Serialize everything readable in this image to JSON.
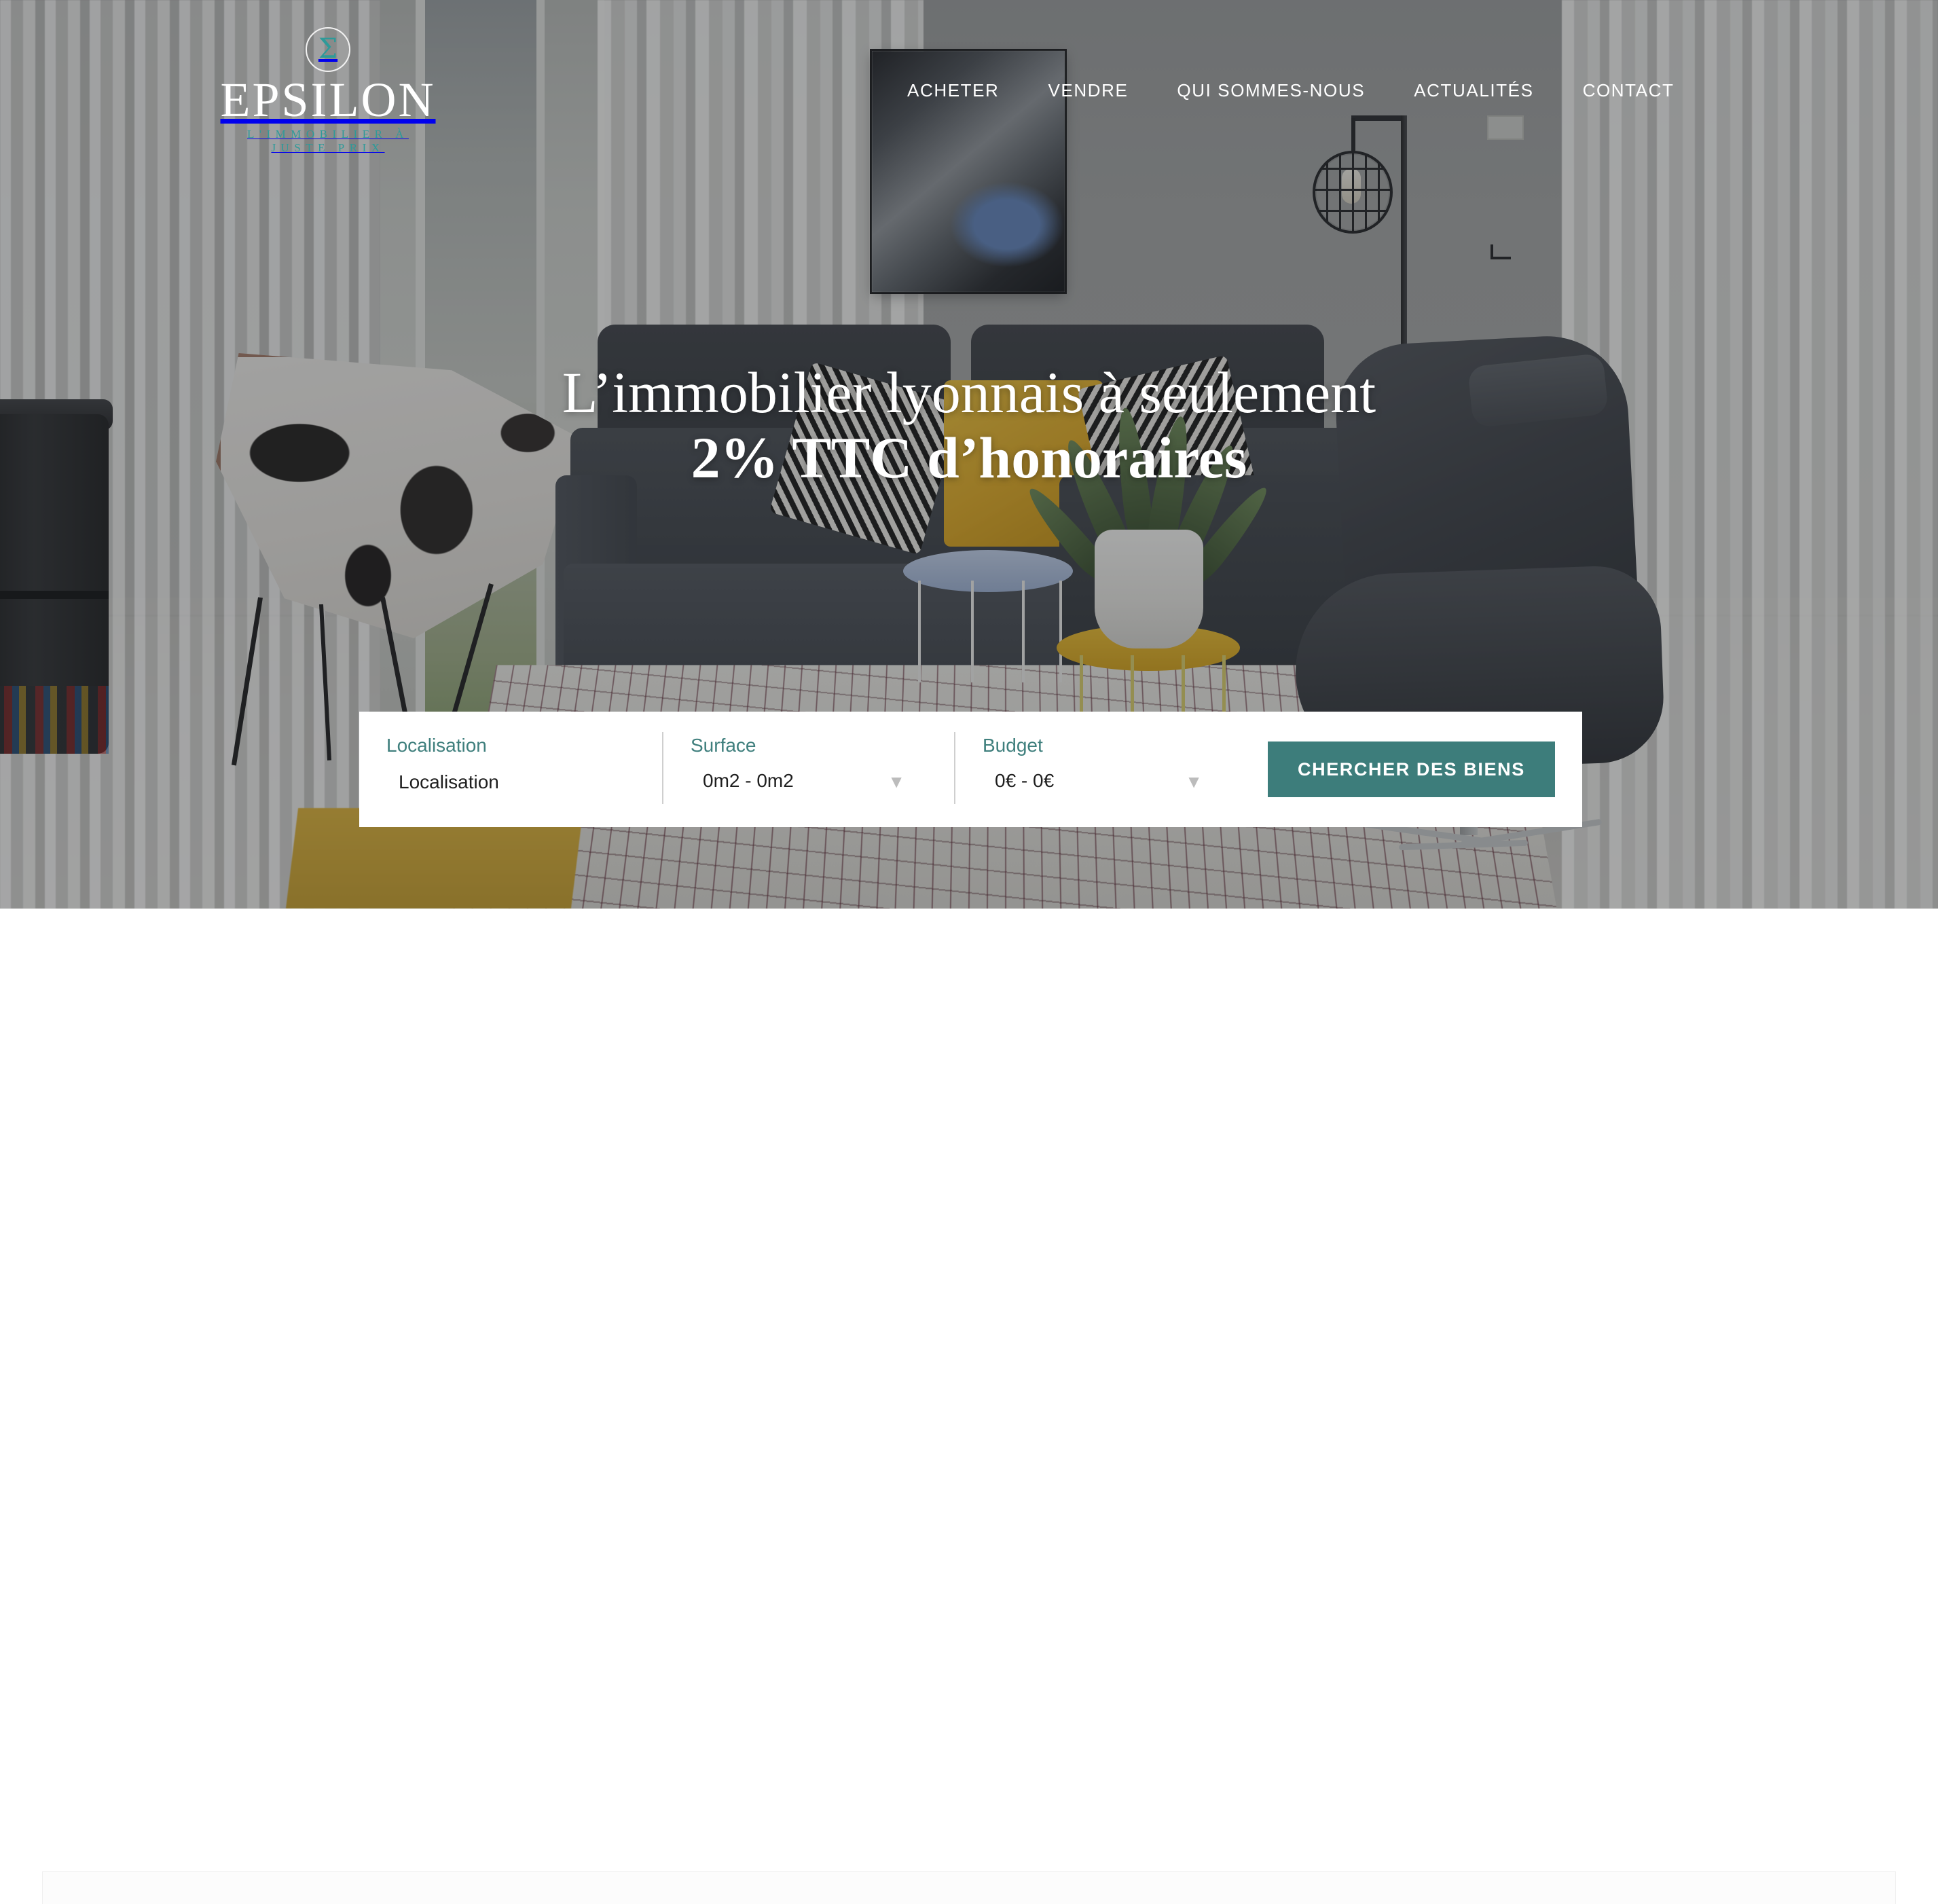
{
  "brand": {
    "sigma_glyph": "Σ",
    "name": "EPSILON",
    "tagline": "L'IMMOBILIER À JUSTE PRIX",
    "logo_icon": "sigma-circle-icon",
    "tagline_color": "#2e9a99"
  },
  "nav": {
    "items": [
      {
        "label": "ACHETER"
      },
      {
        "label": "VENDRE"
      },
      {
        "label": "QUI SOMMES-NOUS"
      },
      {
        "label": "ACTUALITÉS"
      },
      {
        "label": "CONTACT"
      }
    ]
  },
  "hero": {
    "headline_line1": "L’immobilier lyonnais à seulement",
    "headline_line2": "2% TTC d’honoraires",
    "background_description": "living room interior with grey sofa, yellow cushion, armchair, curtains"
  },
  "search": {
    "localisation": {
      "label": "Localisation",
      "value": "Localisation",
      "placeholder": "Localisation"
    },
    "surface": {
      "label": "Surface",
      "value": "0m2 - 0m2",
      "caret": "▼"
    },
    "budget": {
      "label": "Budget",
      "value": "0€ - 0€",
      "caret": "▼"
    },
    "submit_label": "CHERCHER DES BIENS",
    "accent_color": "#3d7d7b",
    "label_color": "#3f7f7d"
  }
}
